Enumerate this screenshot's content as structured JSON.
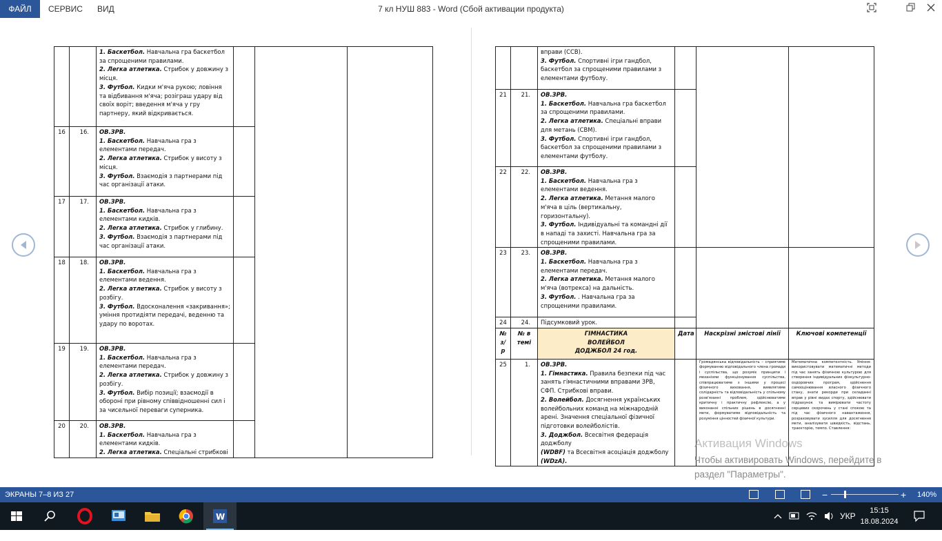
{
  "window": {
    "title": "7 кл НУШ 883 - Word (Сбой активации продукта)",
    "menu": [
      "ФАЙЛ",
      "СЕРВИС",
      "ВИД"
    ]
  },
  "left_table": {
    "rows": [
      {
        "n": "",
        "t": "",
        "lines": [
          {
            "b": "1. Баскетбол.",
            "t": " Навчальна гра баскетбол за спрощеними правилами."
          },
          {
            "b": "2. Легка атлетика.",
            "t": " Стрибок у довжину з місця."
          },
          {
            "b": "3. Футбол.",
            "t": " Кидки м'яча рукою; ловіння та відбивання м'яча; розіграш удару від своїх воріт; введення м'яча у гру партнеру, який відкривається."
          }
        ]
      },
      {
        "n": "16",
        "t": "16.",
        "lines": [
          {
            "b": "ОВ.ЗРВ.",
            "t": ""
          },
          {
            "b": "1. Баскетбол.",
            "t": " Навчальна гра з елементами передач."
          },
          {
            "b": "2. Легка атлетика.",
            "t": " Стрибок у висоту з місця."
          },
          {
            "b": "3. Футбол.",
            "t": " Взаємодія з партнерами під час організації атаки."
          }
        ]
      },
      {
        "n": "17",
        "t": "17.",
        "lines": [
          {
            "b": "ОВ.ЗРВ.",
            "t": ""
          },
          {
            "b": "1. Баскетбол.",
            "t": "  Навчальна гра з елементами кидків."
          },
          {
            "b": "2. Легка атлетика.",
            "t": " Стрибок у глибину."
          },
          {
            "b": "3. Футбол.",
            "t": " Взаємодія з партнерами під час організації атаки."
          }
        ]
      },
      {
        "n": "18",
        "t": "18.",
        "lines": [
          {
            "b": "ОВ.ЗРВ.",
            "t": ""
          },
          {
            "b": "1. Баскетбол.",
            "t": " Навчальна гра з елементами ведення."
          },
          {
            "b": "2. Легка атлетика.",
            "t": " Стрибок у висоту з розбігу."
          },
          {
            "b": "3. Футбол.",
            "t": " Вдосконалення «закривання»; уміння протидіяти передачі, веденню та удару по воротах."
          }
        ]
      },
      {
        "n": "19",
        "t": "19.",
        "lines": [
          {
            "b": "ОВ.ЗРВ.",
            "t": ""
          },
          {
            "b": "1. Баскетбол.",
            "t": " Навчальна гра з елементами передач."
          },
          {
            "b": "2. Легка атлетика.",
            "t": " Стрибок у довжину з розбігу."
          },
          {
            "b": "3. Футбол.",
            "t": "     Вибір позиції; взаємодії в обороні при рівному співвідношенні сил і за чисельної переваги суперника."
          }
        ]
      },
      {
        "n": "20",
        "t": "20.",
        "lines": [
          {
            "b": "ОВ.ЗРВ.",
            "t": ""
          },
          {
            "b": "1. Баскетбол.",
            "t": " Навчальна гра з елементами кидків."
          },
          {
            "b": "2. Легка атлетика.",
            "t": " Спеціальні стрибкові"
          }
        ]
      }
    ]
  },
  "right_table": {
    "rows": [
      {
        "n": "",
        "t": "",
        "lines": [
          {
            "b": "",
            "t": "вправи (ССВ)."
          },
          {
            "b": "3. Футбол.",
            "t": " Спортивні ігри гандбол, баскетбол за спрощеними правилами з елементами футболу."
          }
        ]
      },
      {
        "n": "21",
        "t": "21.",
        "lines": [
          {
            "b": "ОВ.ЗРВ.",
            "t": ""
          },
          {
            "b": "1. Баскетбол.",
            "t": " Навчальна гра баскетбол за спрощеними правилами."
          },
          {
            "b": "2. Легка атлетика.",
            "t": "  Спеціальні вправи для метань (СВМ)."
          },
          {
            "b": "3. Футбол.",
            "t": " Спортивні ігри гандбол, баскетбол за спрощеними правилами з елементами футболу."
          }
        ]
      },
      {
        "n": "22",
        "t": "22.",
        "lines": [
          {
            "b": "ОВ.ЗРВ.",
            "t": ""
          },
          {
            "b": "1. Баскетбол.",
            "t": " Навчальна гра з елементами ведення."
          },
          {
            "b": "2. Легка атлетика.",
            "t": " Метання малого м'яча в ціль (вертикальну, горизонтальну)."
          },
          {
            "b": "3. Футбол.",
            "t": "     Індивідуальні та командні дії в нападі та захисті. Навчальна гра за спрощеними правилами."
          }
        ]
      },
      {
        "n": "23",
        "t": "23.",
        "lines": [
          {
            "b": "ОВ.ЗРВ.",
            "t": ""
          },
          {
            "b": "1. Баскетбол.",
            "t": " Навчальна гра з елементами передач."
          },
          {
            "b": "2. Легка атлетика.",
            "t": " Метання малого м'яча (вотрекса) на дальність."
          },
          {
            "b": "3. Футбол.",
            "t": "   . Навчальна гра за спрощеними правилами."
          }
        ]
      },
      {
        "n": "24",
        "t": "24.",
        "lines": [
          {
            "b": "",
            "t": "Підсумковий урок."
          }
        ]
      }
    ],
    "header": {
      "col1": "№ з/р",
      "col2": "№ в темі",
      "section": [
        "ГІМНАСТИКА",
        "ВОЛЕЙБОЛ",
        "ДОДЖБОЛ 24 год."
      ],
      "date": "Дата",
      "lines": "Наскрізні змістові лінії",
      "comp": "Ключові компетенції"
    },
    "row25": {
      "n": "25",
      "t": "1.",
      "lines": [
        {
          "b": "ОВ.ЗРВ.",
          "t": ""
        },
        {
          "b": "1. Гімнастика.",
          "t": " Правила безпеки під час занять гімнастичними вправами ЗРВ, СФП. Стрибкові вправи."
        },
        {
          "b": "2. Волейбол.",
          "t": "   Досягнення українських волейбольних команд на міжнародній арені. Значення спеціальної фізичної підготовки волейболістів."
        },
        {
          "b": "3. Доджбол.",
          "t": "   Всесвітня федерація доджболу "
        },
        {
          "b": "(WDBF)",
          "t": " та Всесвітня асоціація доджболу "
        },
        {
          "b": "(WDzA).",
          "t": ""
        }
      ],
      "lines_text": "Громадянська відповідальність – сприятиме формуванню відповідального члена громади і суспільства, що розуміє принципи і механізми функціонування суспільства, співпрацюватиме з іншими у процесі фізичного виховання, виявлятиме солідарність та відповідальність у спільному розв'язанні проблем, здійснюватиме критичну і практичну рефлексію, а у виконанні спільних рішень в досягненні мети, формуватиме відповідальність та розуміння цінностей фізичної культури.",
      "comp_text": "Математична компетентність. Уміння: використовувати математичні методи під час занять фізичною культурою для створення індивідуальних фізкультурно-оздоровчих програм, здійснення самооцінювання власного фізичного стану, знати рекорди при складанні вправ у рівні видах спорту, здійснювати підрахунок та вимірювати частоту серцевих скорочень у стані спокою та під час фізичного навантаження, розраховувати зусилля для досягнення мети, аналізувати швидкість, відстань, траєкторію, темпо. Ставлення:"
    }
  },
  "watermark": {
    "line1": "Активация Windows",
    "line2": "Чтобы активировать Windows, перейдите в",
    "line3": "раздел \"Параметры\"."
  },
  "status": {
    "screens": "ЭКРАНЫ 7–8 ИЗ 27",
    "zoom": "140%",
    "zoom_fraction": 0.2
  },
  "taskbar": {
    "lang": "УКР",
    "time": "15:15",
    "date": "18.08.2024"
  }
}
